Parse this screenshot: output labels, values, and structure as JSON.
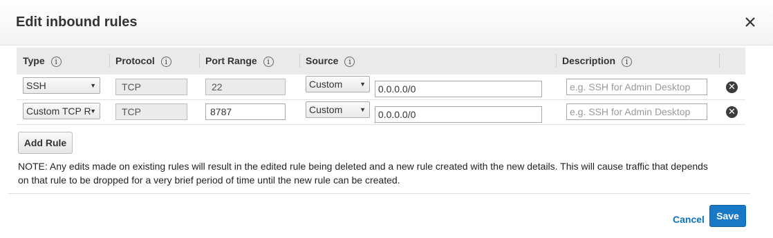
{
  "dialog": {
    "title": "Edit inbound rules",
    "close_icon": "close-icon"
  },
  "table": {
    "headers": {
      "type": "Type",
      "protocol": "Protocol",
      "port_range": "Port Range",
      "source": "Source",
      "description": "Description"
    },
    "info_glyph": "i",
    "rows": [
      {
        "type": "SSH",
        "protocol": "TCP",
        "port_range": "22",
        "source_mode": "Custom",
        "source_value": "0.0.0.0/0",
        "description_placeholder": "e.g. SSH for Admin Desktop"
      },
      {
        "type": "Custom TCP R",
        "protocol": "TCP",
        "port_range": "8787",
        "source_mode": "Custom",
        "source_value": "0.0.0.0/0",
        "description_placeholder": "e.g. SSH for Admin Desktop"
      }
    ],
    "remove_glyph": "✕"
  },
  "add_rule_label": "Add Rule",
  "note": "NOTE: Any edits made on existing rules will result in the edited rule being deleted and a new rule created with the new details. This will cause traffic that depends on that rule to be dropped for a very brief period of time until the new rule can be created.",
  "footer": {
    "cancel_label": "Cancel",
    "save_label": "Save"
  },
  "colors": {
    "primary": "#1979c6",
    "link": "#0b73b8",
    "header_bg": "#eaeaea"
  }
}
